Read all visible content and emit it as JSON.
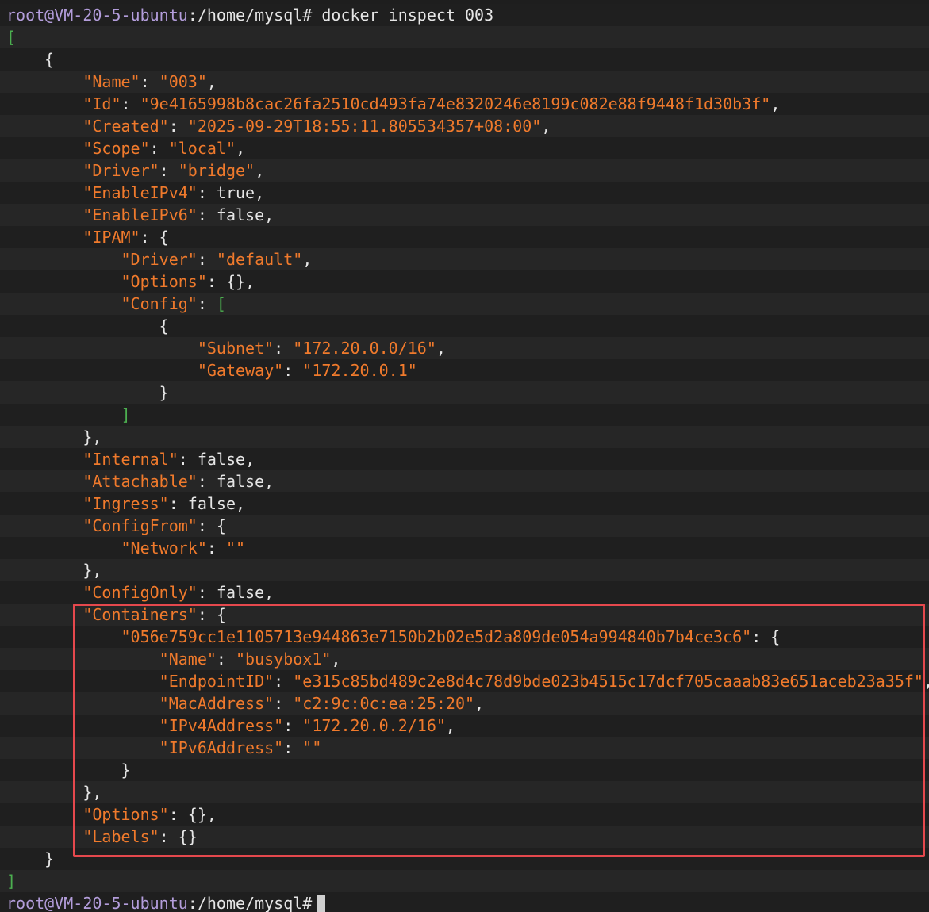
{
  "prompt": {
    "user_host": "root@VM-20-5-ubuntu",
    "sep": ":",
    "path": "/home/mysql",
    "symbol": "#",
    "command": "docker inspect 003"
  },
  "colors": {
    "key": "#f07a2c",
    "bracket": "#4caf50",
    "prompt_user": "#b39ddb",
    "highlight": "#e5484d"
  },
  "json": {
    "name_key": "\"Name\"",
    "name_val": "\"003\"",
    "id_key": "\"Id\"",
    "id_val": "\"9e4165998b8cac26fa2510cd493fa74e8320246e8199c082e88f9448f1d30b3f\"",
    "created_key": "\"Created\"",
    "created_val": "\"2025-09-29T18:55:11.805534357+08:00\"",
    "scope_key": "\"Scope\"",
    "scope_val": "\"local\"",
    "driver_key": "\"Driver\"",
    "driver_val": "\"bridge\"",
    "ipv4_key": "\"EnableIPv4\"",
    "ipv4_val": "true",
    "ipv6_key": "\"EnableIPv6\"",
    "ipv6_val": "false",
    "ipam_key": "\"IPAM\"",
    "ipam_driver_key": "\"Driver\"",
    "ipam_driver_val": "\"default\"",
    "ipam_options_key": "\"Options\"",
    "ipam_options_val": "{}",
    "ipam_config_key": "\"Config\"",
    "subnet_key": "\"Subnet\"",
    "subnet_val": "\"172.20.0.0/16\"",
    "gateway_key": "\"Gateway\"",
    "gateway_val": "\"172.20.0.1\"",
    "internal_key": "\"Internal\"",
    "internal_val": "false",
    "attachable_key": "\"Attachable\"",
    "attachable_val": "false",
    "ingress_key": "\"Ingress\"",
    "ingress_val": "false",
    "configfrom_key": "\"ConfigFrom\"",
    "network_key": "\"Network\"",
    "network_val": "\"\"",
    "configonly_key": "\"ConfigOnly\"",
    "configonly_val": "false",
    "containers_key": "\"Containers\"",
    "container_id": "\"056e759cc1e1105713e944863e7150b2b02e5d2a809de054a994840b7b4ce3c6\"",
    "c_name_key": "\"Name\"",
    "c_name_val": "\"busybox1\"",
    "c_endpoint_key": "\"EndpointID\"",
    "c_endpoint_val": "\"e315c85bd489c2e8d4c78d9bde023b4515c17dcf705caaab83e651aceb23a35f\"",
    "c_mac_key": "\"MacAddress\"",
    "c_mac_val": "\"c2:9c:0c:ea:25:20\"",
    "c_ipv4_key": "\"IPv4Address\"",
    "c_ipv4_val": "\"172.20.0.2/16\"",
    "c_ipv6_key": "\"IPv6Address\"",
    "c_ipv6_val": "\"\"",
    "options_key": "\"Options\"",
    "options_val": "{}",
    "labels_key": "\"Labels\"",
    "labels_val": "{}"
  }
}
